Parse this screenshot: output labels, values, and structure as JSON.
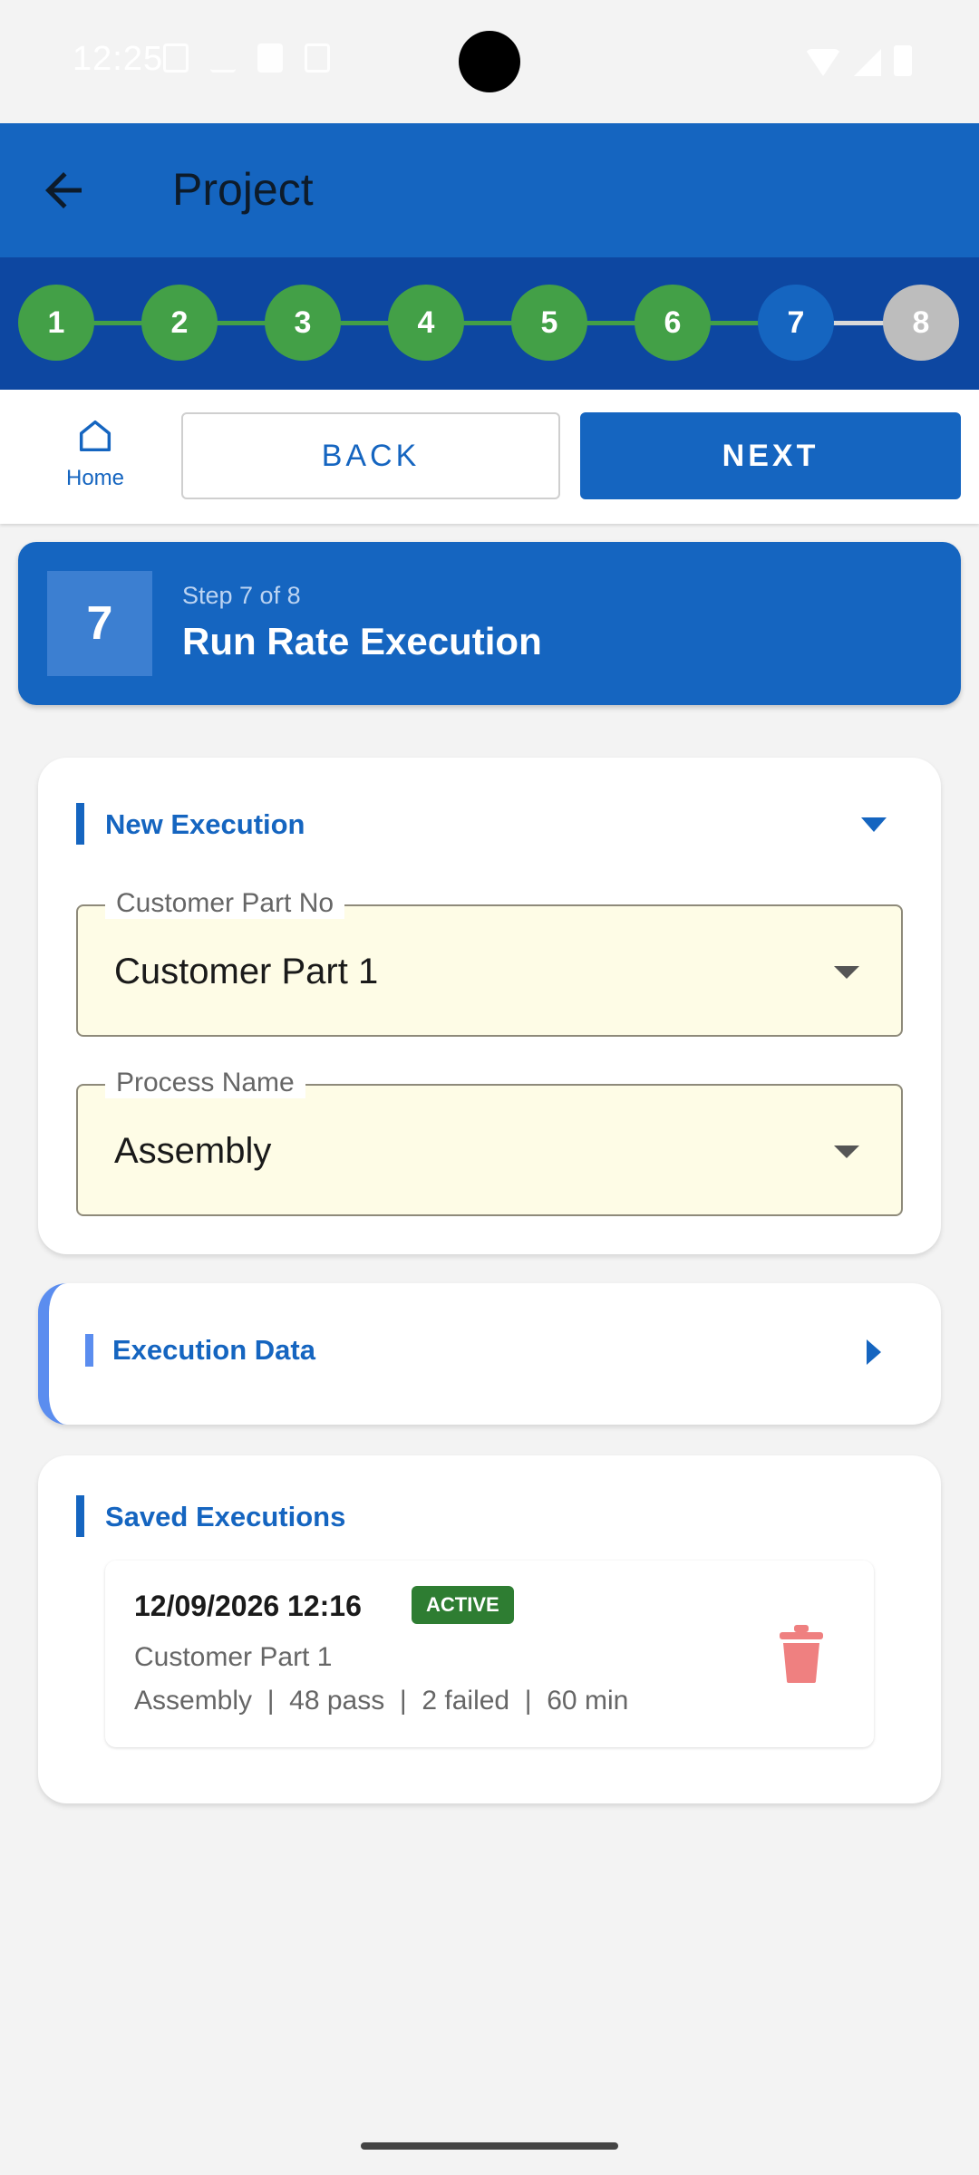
{
  "status_bar": {
    "time": "12:25"
  },
  "app_bar": {
    "title": "Project"
  },
  "stepper": {
    "steps": [
      "1",
      "2",
      "3",
      "4",
      "5",
      "6",
      "7",
      "8"
    ],
    "current": 7,
    "completed_color": "#43a047",
    "current_color": "#1565c0",
    "pending_color": "#bdbdbd"
  },
  "nav": {
    "home_label": "Home",
    "back_label": "BACK",
    "next_label": "NEXT"
  },
  "step_banner": {
    "number": "7",
    "subtitle": "Step 7 of 8",
    "title": "Run Rate Execution"
  },
  "new_execution": {
    "title": "New Execution",
    "customer_part": {
      "label": "Customer Part No",
      "value": "Customer Part 1"
    },
    "process": {
      "label": "Process Name",
      "value": "Assembly"
    }
  },
  "execution_data": {
    "title": "Execution Data"
  },
  "saved_executions": {
    "title": "Saved Executions",
    "items": [
      {
        "datetime": "12/09/2026 12:16",
        "status": "ACTIVE",
        "part": "Customer Part 1",
        "meta": "Assembly  |  48 pass  |  2 failed  |  60 min"
      }
    ]
  },
  "icons": [
    "back-arrow-icon",
    "home-icon",
    "caret-down-icon",
    "caret-right-icon",
    "trash-icon"
  ]
}
